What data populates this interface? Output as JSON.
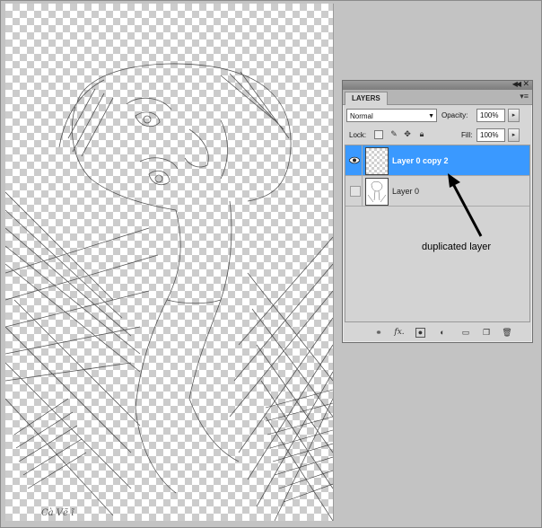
{
  "canvas": {
    "signature": "Cà Vẽ ĩ"
  },
  "layers_panel": {
    "tab_label": "LAYERS",
    "blend_mode": "Normal",
    "opacity_label": "Opacity:",
    "opacity_value": "100%",
    "lock_label": "Lock:",
    "fill_label": "Fill:",
    "fill_value": "100%",
    "layers": [
      {
        "name": "Layer 0 copy 2",
        "visible": true,
        "selected": true
      },
      {
        "name": "Layer 0",
        "visible": false,
        "selected": false
      }
    ],
    "footer_icons": [
      "link-icon",
      "fx-icon",
      "mask-icon",
      "adjustment-icon",
      "folder-icon",
      "new-layer-icon",
      "trash-icon"
    ],
    "fx_label": "fx."
  },
  "annotation": {
    "text": "duplicated layer"
  },
  "colors": {
    "selection": "#3a99ff",
    "panel": "#d6d6d6"
  }
}
